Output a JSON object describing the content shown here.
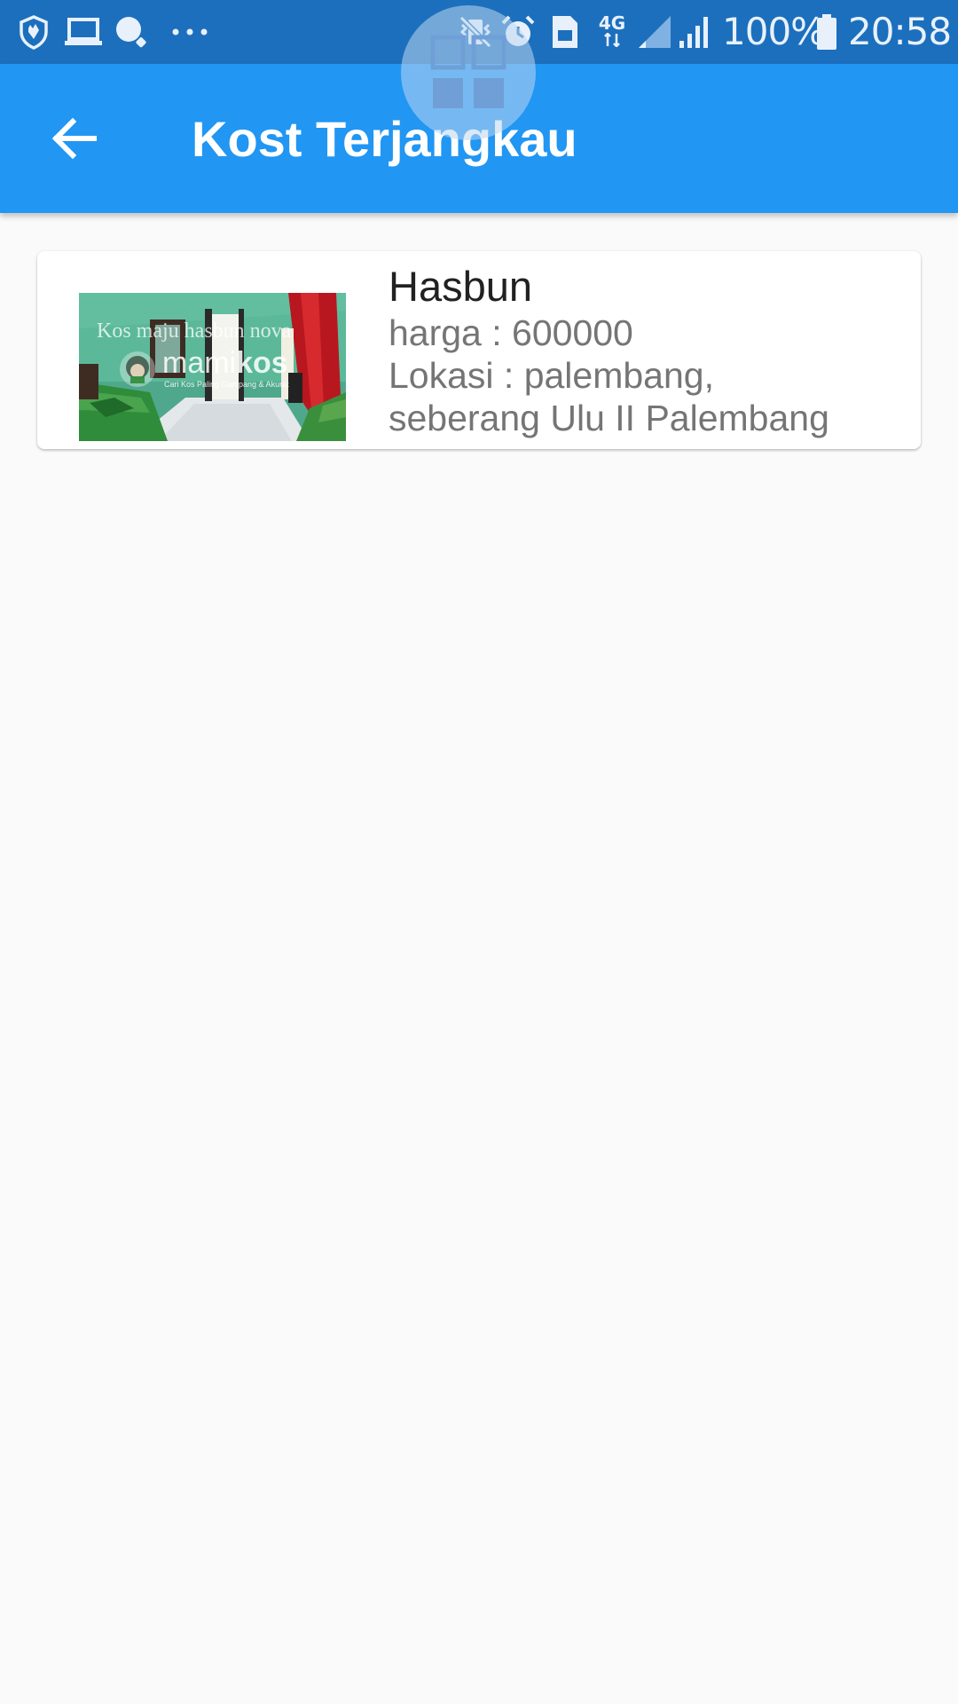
{
  "status_bar": {
    "network_type": "4G",
    "battery": "100%",
    "time": "20:58",
    "icons": [
      "shield-icon",
      "laptop-icon",
      "search-icon",
      "more-icon",
      "vibrate-icon",
      "alarm-icon",
      "sim-icon",
      "network-icon",
      "signal-icon",
      "battery-icon"
    ]
  },
  "app_bar": {
    "title": "Kost Terjangkau",
    "back_icon": "arrow-back-icon",
    "color": "#2196f3"
  },
  "overlay": {
    "icon": "grid-icon"
  },
  "listings": [
    {
      "name": "Hasbun",
      "price": "harga : 600000",
      "location_line1": "Lokasi : palembang,",
      "location_line2": "seberang Ulu II Palembang",
      "photo": {
        "caption": "Kos maju hasbun nova",
        "brand_prefix": "mami",
        "brand_suffix": "kos",
        "tagline": "Cari Kos Paling Gampang & Akurat"
      }
    }
  ]
}
